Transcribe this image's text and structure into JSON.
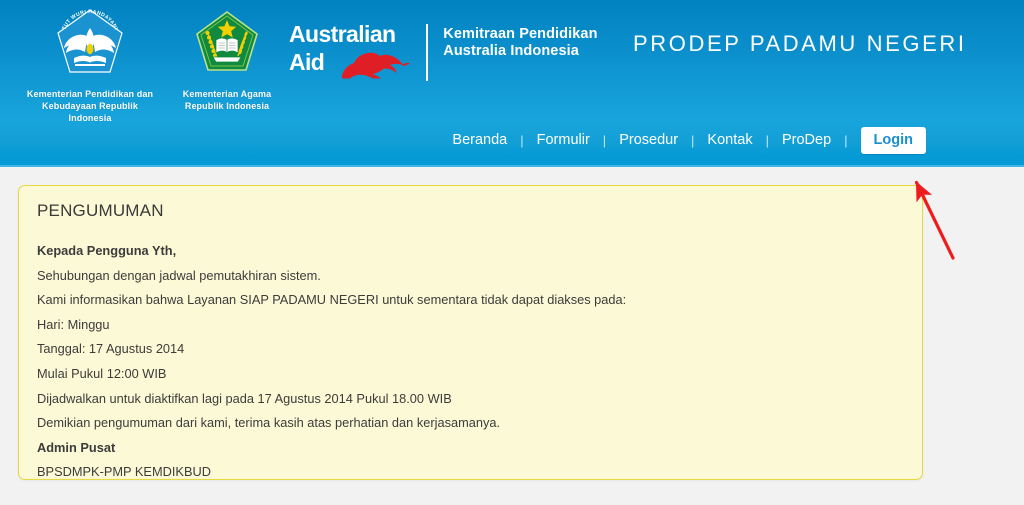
{
  "header": {
    "logos": [
      {
        "name": "kemdikbud-logo",
        "caption": "Kementerian Pendidikan dan\nKebudayaan Republik Indonesia",
        "motto": "TUT WURI HANDAYANI"
      },
      {
        "name": "kemenag-logo",
        "caption": "Kementerian Agama\nRepublik Indonesia"
      }
    ],
    "australian_aid": {
      "line1": "Australian",
      "line2": "Aid",
      "icon": "kangaroo-icon"
    },
    "partnership": "Kemitraan Pendidikan\nAustralia Indonesia",
    "brand_title": "PRODEP PADAMU NEGERI"
  },
  "nav": {
    "items": [
      {
        "label": "Beranda"
      },
      {
        "label": "Formulir"
      },
      {
        "label": "Prosedur"
      },
      {
        "label": "Kontak"
      },
      {
        "label": "ProDep"
      }
    ],
    "separator": "|",
    "login_label": "Login"
  },
  "announcement": {
    "title": "PENGUMUMAN",
    "lines": [
      {
        "text": "Kepada Pengguna Yth,",
        "bold": true
      },
      {
        "text": "Sehubungan dengan jadwal pemutakhiran sistem.",
        "bold": false
      },
      {
        "text": "Kami informasikan bahwa Layanan SIAP PADAMU NEGERI untuk sementara tidak dapat diakses pada:",
        "bold": false
      },
      {
        "text": "Hari: Minggu",
        "bold": false
      },
      {
        "text": "Tanggal: 17 Agustus 2014",
        "bold": false
      },
      {
        "text": "Mulai Pukul 12:00 WIB",
        "bold": false
      },
      {
        "text": "Dijadwalkan untuk diaktifkan lagi pada 17 Agustus 2014 Pukul 18.00 WIB",
        "bold": false
      },
      {
        "text": "Demikian pengumuman dari kami, terima kasih atas perhatian dan kerjasamanya.",
        "bold": false
      },
      {
        "text": "Admin Pusat",
        "bold": true
      },
      {
        "text": "BPSDMPK-PMP KEMDIKBUD",
        "bold": false
      }
    ]
  },
  "annotation": {
    "name": "red-arrow-pointer",
    "color": "#ee1c1c",
    "points_to": "Login"
  },
  "colors": {
    "header_blue_top": "#0082bf",
    "header_blue_bottom": "#18a5dc",
    "page_background": "#f2f2f3",
    "card_background": "#fcf9d7",
    "card_border": "#e9d93e",
    "login_text": "#1a8fd0",
    "annotation_red": "#ee1c1c"
  }
}
